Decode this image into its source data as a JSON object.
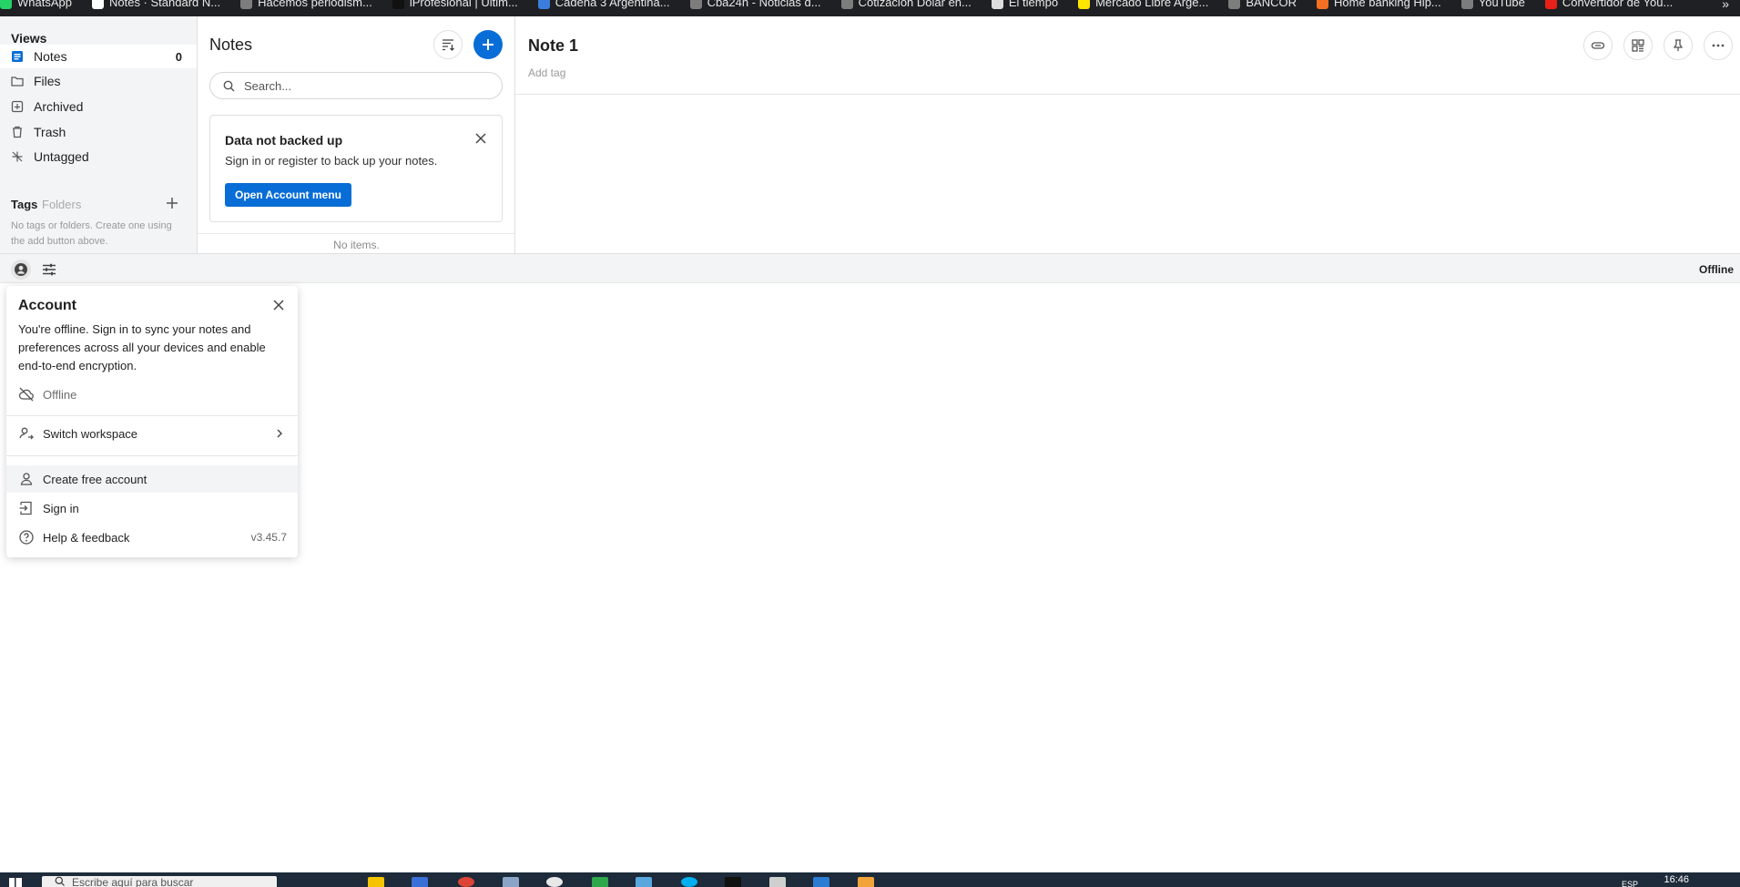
{
  "bookmarks": [
    {
      "label": "WhatsApp",
      "color": "#25d366"
    },
    {
      "label": "Notes · Standard N...",
      "color": "#ffffff"
    },
    {
      "label": "Hacemos periodism...",
      "color": "#7d7d7d"
    },
    {
      "label": "iProfesional | Últim...",
      "color": "#111111"
    },
    {
      "label": "Cadena 3 Argentina...",
      "color": "#3b7ddd"
    },
    {
      "label": "Cba24n - Noticias d...",
      "color": "#7d7d7d"
    },
    {
      "label": "Cotización Dólar en...",
      "color": "#7d7d7d"
    },
    {
      "label": "El tiempo",
      "color": "#dddddd"
    },
    {
      "label": "Mercado Libre Arge...",
      "color": "#ffe600"
    },
    {
      "label": "BANCOR",
      "color": "#7d7d7d"
    },
    {
      "label": "Home banking Hip...",
      "color": "#f36f21"
    },
    {
      "label": "YouTube",
      "color": "#7d7d7d"
    },
    {
      "label": "Convertidor de You...",
      "color": "#e62117"
    }
  ],
  "bookmarks_more": "»",
  "sidebar": {
    "views_title": "Views",
    "items": [
      {
        "label": "Notes",
        "count": "0",
        "icon": "notes-icon"
      },
      {
        "label": "Files",
        "icon": "folder-icon"
      },
      {
        "label": "Archived",
        "icon": "archive-icon"
      },
      {
        "label": "Trash",
        "icon": "trash-icon"
      },
      {
        "label": "Untagged",
        "icon": "untagged-icon"
      }
    ],
    "tags_title": "Tags",
    "folders_label": "Folders",
    "tags_empty": "No tags or folders. Create one using the add button above."
  },
  "items_panel": {
    "title": "Notes",
    "search_placeholder": "Search...",
    "notice": {
      "title": "Data not backed up",
      "text": "Sign in or register to back up your notes.",
      "button": "Open Account menu"
    },
    "empty": "No items."
  },
  "editor": {
    "title": "Note 1",
    "add_tag": "Add tag"
  },
  "footer": {
    "status": "Offline"
  },
  "account_menu": {
    "title": "Account",
    "description": "You're offline. Sign in to sync your notes and preferences across all your devices and enable end-to-end encryption.",
    "offline": "Offline",
    "switch_workspace": "Switch workspace",
    "create_account": "Create free account",
    "sign_in": "Sign in",
    "help": "Help & feedback",
    "version": "v3.45.7"
  },
  "taskbar": {
    "search_placeholder": "Escribe aquí para buscar",
    "lang": "ESP",
    "time": "16:46"
  },
  "colors": {
    "accent": "#086dd6",
    "sidebar_bg": "#f3f4f6",
    "bookmarks_bg": "#1f2023",
    "taskbar_bg": "#1d2b3a"
  }
}
